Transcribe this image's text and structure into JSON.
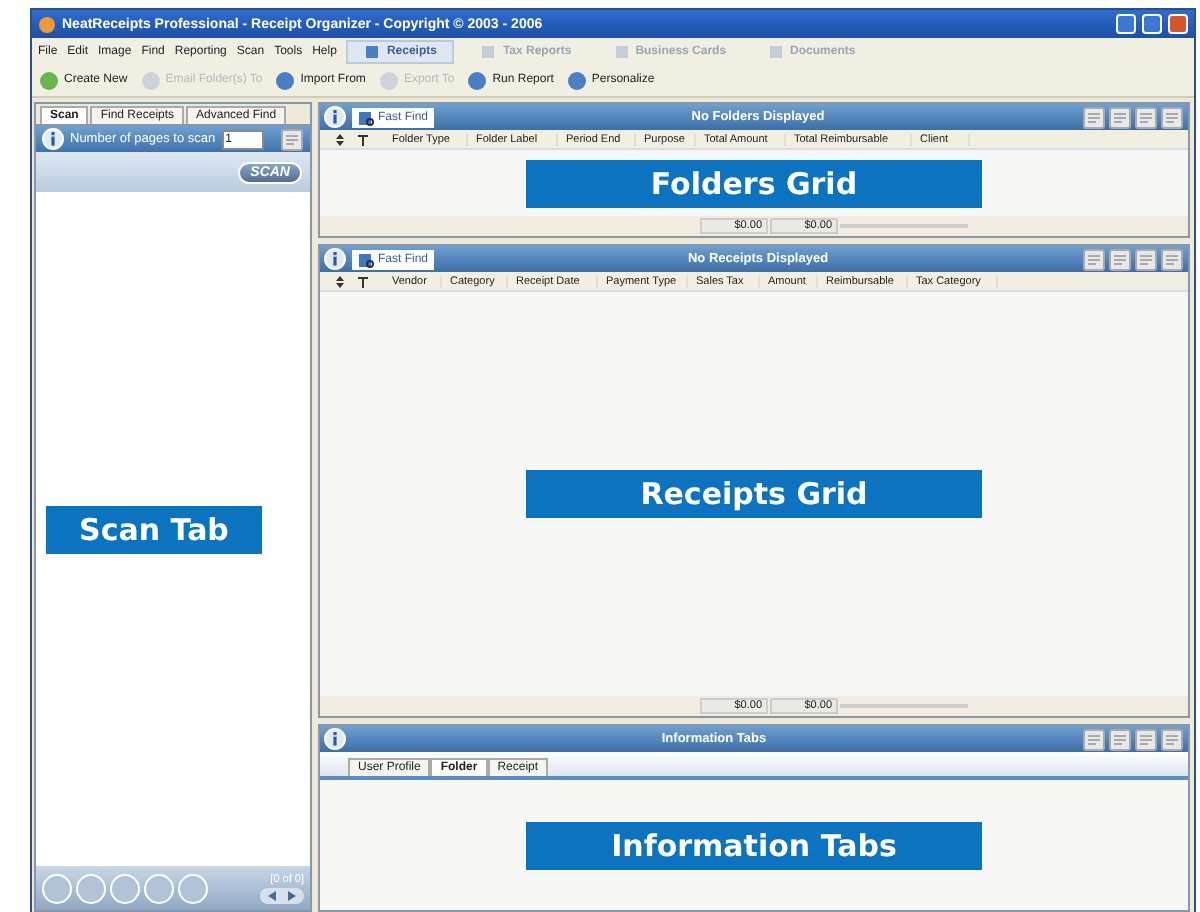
{
  "window": {
    "title": "NeatReceipts Professional - Receipt Organizer - Copyright © 2003 - 2006"
  },
  "menu": [
    "File",
    "Edit",
    "Image",
    "Find",
    "Reporting",
    "Scan",
    "Tools",
    "Help"
  ],
  "nav_tabs": [
    {
      "label": "Receipts",
      "selected": true
    },
    {
      "label": "Tax Reports",
      "selected": false
    },
    {
      "label": "Business Cards",
      "selected": false
    },
    {
      "label": "Documents",
      "selected": false
    }
  ],
  "toolbar": [
    {
      "label": "Create New",
      "disabled": false
    },
    {
      "label": "Email Folder(s) To",
      "disabled": true
    },
    {
      "label": "Import From",
      "disabled": false
    },
    {
      "label": "Export To",
      "disabled": true
    },
    {
      "label": "Run Report",
      "disabled": false
    },
    {
      "label": "Personalize",
      "disabled": false
    }
  ],
  "scan_panel": {
    "tabs": [
      {
        "label": "Scan",
        "selected": true
      },
      {
        "label": "Find Receipts",
        "selected": false
      },
      {
        "label": "Advanced Find",
        "selected": false
      }
    ],
    "pages_label": "Number of pages to scan",
    "pages_value": "1",
    "scan_button": "SCAN",
    "page_count": "[0 of 0]",
    "callout": "Scan Tab"
  },
  "folders_grid": {
    "fast_find": "Fast Find",
    "status": "No Folders Displayed",
    "columns": [
      "Folder Type",
      "Folder Label",
      "Period End",
      "Purpose",
      "Total Amount",
      "Total Reimbursable",
      "Client"
    ],
    "totals": [
      "$0.00",
      "$0.00"
    ],
    "callout": "Folders Grid"
  },
  "receipts_grid": {
    "fast_find": "Fast Find",
    "status": "No Receipts Displayed",
    "columns": [
      "Vendor",
      "Category",
      "Receipt Date",
      "Payment Type",
      "Sales Tax",
      "Amount",
      "Reimbursable",
      "Tax Category"
    ],
    "totals": [
      "$0.00",
      "$0.00"
    ],
    "callout": "Receipts Grid"
  },
  "info_panel": {
    "title": "Information Tabs",
    "tabs": [
      {
        "label": "User Profile",
        "selected": false
      },
      {
        "label": "Folder",
        "selected": true
      },
      {
        "label": "Receipt",
        "selected": false
      }
    ],
    "callout": "Information Tabs"
  }
}
